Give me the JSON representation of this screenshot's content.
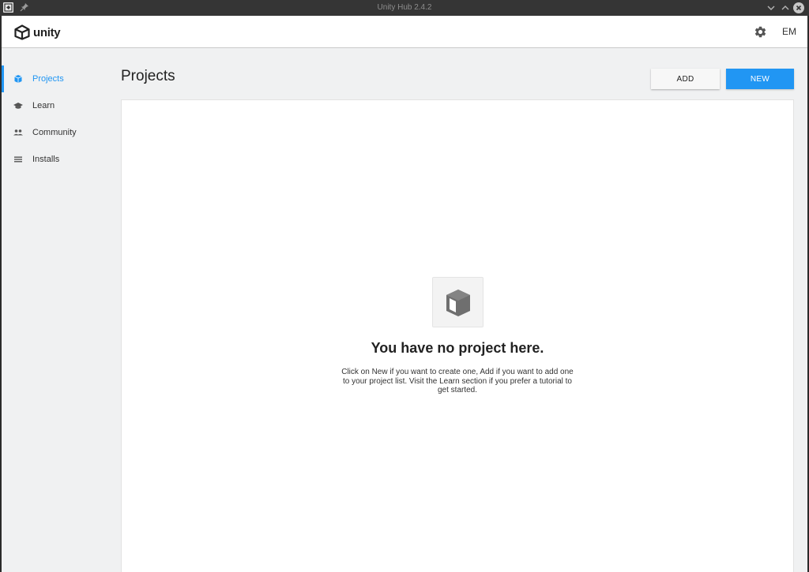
{
  "window": {
    "title": "Unity Hub 2.4.2"
  },
  "header": {
    "logo_text": "unity",
    "avatar_initials": "EM"
  },
  "sidebar": {
    "items": [
      {
        "label": "Projects",
        "icon": "cube-icon",
        "active": true
      },
      {
        "label": "Learn",
        "icon": "graduation-cap-icon",
        "active": false
      },
      {
        "label": "Community",
        "icon": "people-icon",
        "active": false
      },
      {
        "label": "Installs",
        "icon": "list-icon",
        "active": false
      }
    ]
  },
  "main": {
    "title": "Projects",
    "add_label": "ADD",
    "new_label": "NEW",
    "empty_state": {
      "icon": "cube-icon",
      "title": "You have no project here.",
      "description": "Click on New if you want to create one, Add if you want to add one to your project list. Visit the Learn section if you prefer a tutorial to get started."
    }
  },
  "colors": {
    "accent": "#2196f3",
    "sidebar_bg": "#f0f1f2",
    "titlebar_bg": "#353535"
  }
}
